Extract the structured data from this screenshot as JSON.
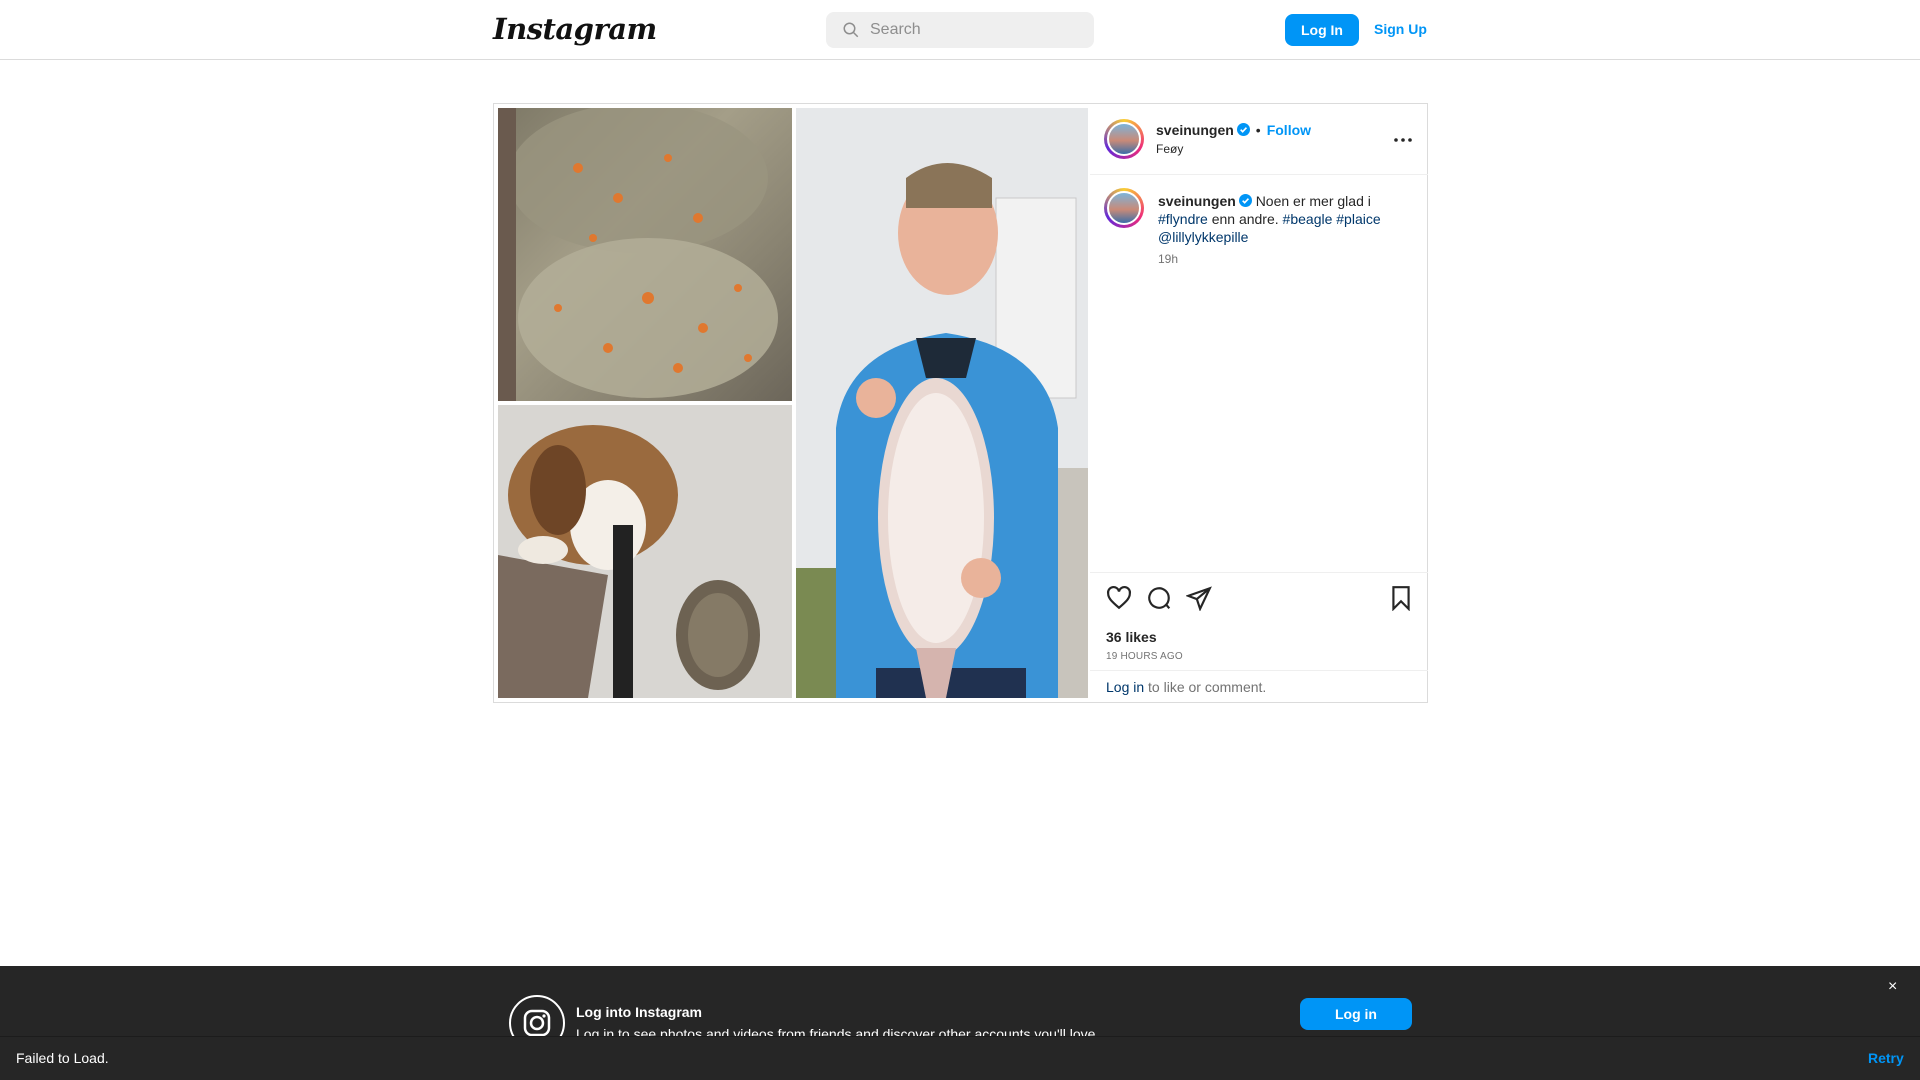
{
  "header": {
    "logo": "Instagram",
    "search_placeholder": "Search",
    "login_label": "Log In",
    "signup_label": "Sign Up"
  },
  "post": {
    "username": "sveinungen",
    "follow_label": "Follow",
    "location": "Feøy",
    "caption": {
      "username": "sveinungen",
      "text_1": "Noen er mer glad i",
      "tag_flyndre": "#flyndre",
      "text_2": "enn andre.",
      "tag_beagle": "#beagle",
      "tag_plaice": "#plaice",
      "mention": "@lillylykkepille",
      "time": "19h"
    },
    "likes": "36 likes",
    "posted_ago": "19 HOURS AGO",
    "login_link": "Log in",
    "login_suffix": "to like or comment."
  },
  "banner": {
    "title": "Log into Instagram",
    "subtitle": "Log in to see photos and videos from friends and discover other accounts you'll love.",
    "login_label": "Log in",
    "close_glyph": "×"
  },
  "error": {
    "message": "Failed to Load.",
    "retry_label": "Retry"
  },
  "colors": {
    "accent": "#0095f6",
    "link": "#00376b",
    "dark_bar": "#262626"
  },
  "icons": [
    "search-icon",
    "verified-icon",
    "more-icon",
    "heart-icon",
    "comment-icon",
    "share-icon",
    "bookmark-icon",
    "instagram-glyph-icon",
    "close-icon"
  ]
}
